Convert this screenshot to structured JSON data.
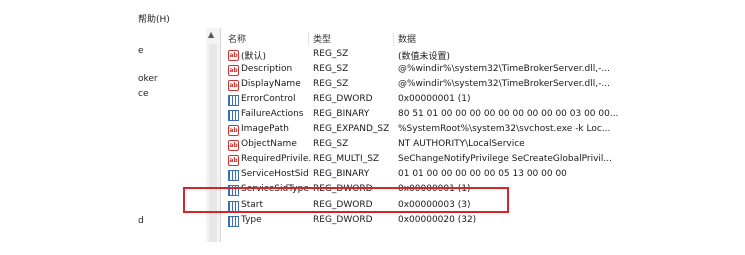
{
  "menu": {
    "help_label": "帮助(H)"
  },
  "tree": {
    "fragments": [
      "e",
      "oker",
      "ce",
      "d"
    ]
  },
  "columns": {
    "name": "名称",
    "type": "类型",
    "data": "数据"
  },
  "rows": [
    {
      "name": "(默认)",
      "type": "REG_SZ",
      "data": "(数值未设置)",
      "icon": "string-value-icon"
    },
    {
      "name": "Description",
      "type": "REG_SZ",
      "data": "@%windir%\\system32\\TimeBrokerServer.dll,-...",
      "icon": "string-value-icon"
    },
    {
      "name": "DisplayName",
      "type": "REG_SZ",
      "data": "@%windir%\\system32\\TimeBrokerServer.dll,-...",
      "icon": "string-value-icon"
    },
    {
      "name": "ErrorControl",
      "type": "REG_DWORD",
      "data": "0x00000001 (1)",
      "icon": "binary-value-icon"
    },
    {
      "name": "FailureActions",
      "type": "REG_BINARY",
      "data": "80 51 01 00 00 00 00 00 00 00 00 00 03 00 00...",
      "icon": "binary-value-icon"
    },
    {
      "name": "ImagePath",
      "type": "REG_EXPAND_SZ",
      "data": "%SystemRoot%\\system32\\svchost.exe -k Loc...",
      "icon": "string-value-icon"
    },
    {
      "name": "ObjectName",
      "type": "REG_SZ",
      "data": "NT AUTHORITY\\LocalService",
      "icon": "string-value-icon"
    },
    {
      "name": "RequiredPrivile...",
      "type": "REG_MULTI_SZ",
      "data": "SeChangeNotifyPrivilege SeCreateGlobalPrivil...",
      "icon": "string-value-icon"
    },
    {
      "name": "ServiceHostSid",
      "type": "REG_BINARY",
      "data": "01 01 00 00 00 00 00 05 13 00 00 00",
      "icon": "binary-value-icon"
    },
    {
      "name": "ServiceSidType",
      "type": "REG_DWORD",
      "data": "0x00000001 (1)",
      "icon": "binary-value-icon"
    },
    {
      "name": "Start",
      "type": "REG_DWORD",
      "data": "0x00000003 (3)",
      "icon": "binary-value-icon"
    },
    {
      "name": "Type",
      "type": "REG_DWORD",
      "data": "0x00000020 (32)",
      "icon": "binary-value-icon"
    }
  ],
  "colors": {
    "highlight_border": "#d8232a",
    "string_icon": "#cc3333",
    "binary_icon": "#3a6fb7"
  }
}
